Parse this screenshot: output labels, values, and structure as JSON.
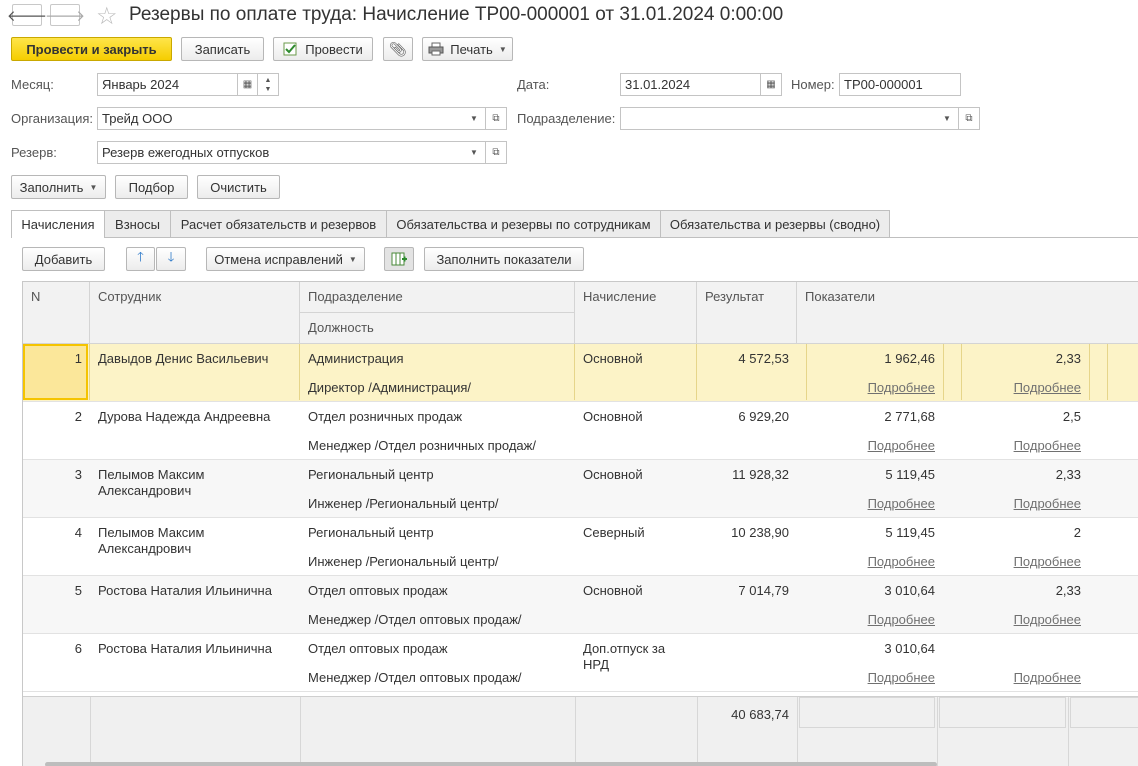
{
  "window": {
    "title": "Резервы по оплате труда: Начисление ТР00-000001 от 31.01.2024 0:00:00",
    "back_icon": "arrow-left-icon",
    "forward_icon": "arrow-right-icon",
    "star_icon": "star-icon"
  },
  "toolbar": {
    "post_close": "Провести и закрыть",
    "save": "Записать",
    "post": "Провести",
    "print": "Печать"
  },
  "form": {
    "month_label": "Месяц:",
    "month_value": "Январь 2024",
    "date_label": "Дата:",
    "date_value": "31.01.2024",
    "number_label": "Номер:",
    "number_value": "ТР00-000001",
    "org_label": "Организация:",
    "org_value": "Трейд ООО",
    "dept_label": "Подразделение:",
    "dept_value": "",
    "reserve_label": "Резерв:",
    "reserve_value": "Резерв ежегодных отпусков"
  },
  "actions": {
    "fill": "Заполнить",
    "pick": "Подбор",
    "clear": "Очистить"
  },
  "tabs": [
    {
      "label": "Начисления"
    },
    {
      "label": "Взносы"
    },
    {
      "label": "Расчет обязательств и резервов"
    },
    {
      "label": "Обязательства и резервы по сотрудникам"
    },
    {
      "label": "Обязательства и резервы (сводно)"
    }
  ],
  "table_toolbar": {
    "add": "Добавить",
    "cancel_fix": "Отмена исправлений",
    "fill_indicators": "Заполнить показатели"
  },
  "table": {
    "headers": {
      "n": "N",
      "employee": "Сотрудник",
      "department": "Подразделение",
      "position": "Должность",
      "accrual": "Начисление",
      "result": "Результат",
      "indicators": "Показатели"
    },
    "rows": [
      {
        "n": "1",
        "employee1": "Давыдов Денис Васильевич",
        "employee2": "",
        "dept": "Администрация",
        "position": "Директор /Администрация/",
        "accrual1": "Основной",
        "accrual2": "",
        "result": "4 572,53",
        "ind1": "1 962,46",
        "ind2": "2,33",
        "more1": "Подробнее",
        "more2": "Подробнее"
      },
      {
        "n": "2",
        "employee1": "Дурова Надежда Андреевна",
        "employee2": "",
        "dept": "Отдел розничных продаж",
        "position": "Менеджер /Отдел розничных продаж/",
        "accrual1": "Основной",
        "accrual2": "",
        "result": "6 929,20",
        "ind1": "2 771,68",
        "ind2": "2,5",
        "more1": "Подробнее",
        "more2": "Подробнее"
      },
      {
        "n": "3",
        "employee1": "Пелымов Максим",
        "employee2": "Александрович",
        "dept": "Региональный центр",
        "position": "Инженер /Региональный центр/",
        "accrual1": "Основной",
        "accrual2": "",
        "result": "11 928,32",
        "ind1": "5 119,45",
        "ind2": "2,33",
        "more1": "Подробнее",
        "more2": "Подробнее"
      },
      {
        "n": "4",
        "employee1": "Пелымов Максим",
        "employee2": "Александрович",
        "dept": "Региональный центр",
        "position": "Инженер /Региональный центр/",
        "accrual1": "Северный",
        "accrual2": "",
        "result": "10 238,90",
        "ind1": "5 119,45",
        "ind2": "2",
        "more1": "Подробнее",
        "more2": "Подробнее"
      },
      {
        "n": "5",
        "employee1": "Ростова Наталия Ильинична",
        "employee2": "",
        "dept": "Отдел оптовых продаж",
        "position": "Менеджер /Отдел оптовых продаж/",
        "accrual1": "Основной",
        "accrual2": "",
        "result": "7 014,79",
        "ind1": "3 010,64",
        "ind2": "2,33",
        "more1": "Подробнее",
        "more2": "Подробнее"
      },
      {
        "n": "6",
        "employee1": "Ростова Наталия Ильинична",
        "employee2": "",
        "dept": "Отдел оптовых продаж",
        "position": "Менеджер /Отдел оптовых продаж/",
        "accrual1": "Доп.отпуск за",
        "accrual2": "НРД",
        "result": "",
        "ind1": "3 010,64",
        "ind2": "",
        "more1": "Подробнее",
        "more2": "Подробнее"
      }
    ],
    "total_result": "40 683,74"
  }
}
